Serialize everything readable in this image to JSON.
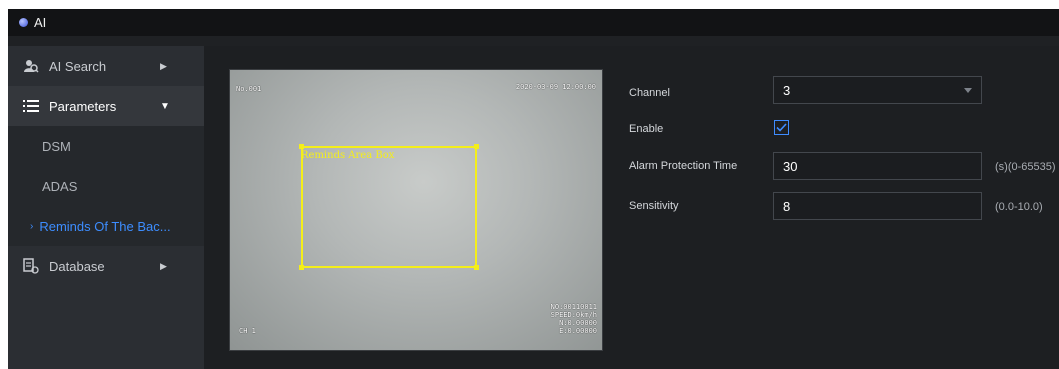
{
  "window": {
    "title": "AI"
  },
  "sidebar": {
    "items": [
      {
        "label": "AI Search",
        "icon": "search-person-icon"
      },
      {
        "label": "Parameters",
        "icon": "list-icon"
      },
      {
        "label": "Database",
        "icon": "database-icon"
      }
    ],
    "sub_items": [
      {
        "label": "DSM"
      },
      {
        "label": "ADAS"
      },
      {
        "label": "Reminds Of The Bac..."
      }
    ]
  },
  "video": {
    "channel_osd": "No.001",
    "timestamp_osd": "2020-03-09 12:00:00",
    "bottom_left_osd": "CH 1",
    "bottom_right_osd": [
      "NO:00110011",
      "SPEED:0km/h",
      "N:0.00000",
      "E:0.00000"
    ],
    "area_label": "Reminds Area Box"
  },
  "form": {
    "channel": {
      "label": "Channel",
      "value": "3"
    },
    "enable": {
      "label": "Enable",
      "checked": true
    },
    "alarm_protection": {
      "label": "Alarm Protection Time",
      "value": "30",
      "unit": "(s)(0-65535)"
    },
    "sensitivity": {
      "label": "Sensitivity",
      "value": "8",
      "unit": "(0.0-10.0)"
    }
  },
  "colors": {
    "accent": "#3d8dff",
    "area_box": "#f4ee1a"
  }
}
